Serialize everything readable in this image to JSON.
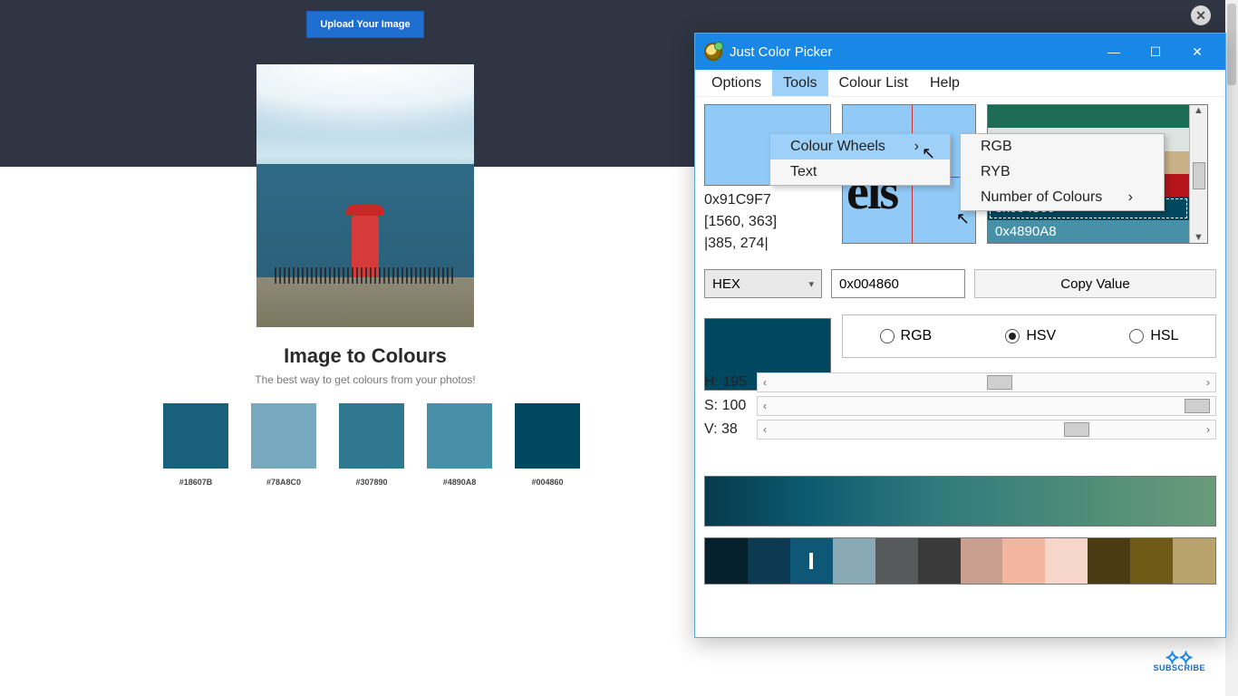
{
  "page": {
    "upload_label": "Upload Your Image",
    "title": "Image to Colours",
    "subtitle": "The best way to get colours from your photos!",
    "swatches": [
      {
        "hex": "#18607B",
        "label": "#18607B"
      },
      {
        "hex": "#78A8C0",
        "label": "#78A8C0"
      },
      {
        "hex": "#307890",
        "label": "#307890"
      },
      {
        "hex": "#4890A8",
        "label": "#4890A8"
      },
      {
        "hex": "#004860",
        "label": "#004860"
      }
    ]
  },
  "jcp": {
    "title": "Just Color Picker",
    "menus": {
      "options": "Options",
      "tools": "Tools",
      "colour_list": "Colour List",
      "help": "Help"
    },
    "tools_menu": {
      "colour_wheels": "Colour Wheels",
      "text": "Text"
    },
    "wheels_menu": {
      "rgb": "RGB",
      "ryb": "RYB",
      "num": "Number of Colours"
    },
    "sample": {
      "hex": "0x91C9F7",
      "coords1": "[1560, 363]",
      "coords2": "|385, 274|",
      "zoom_text": "els"
    },
    "history": [
      {
        "hex": "0x1E6B53",
        "bg": "#1E6B53",
        "text": ""
      },
      {
        "hex": "0xDDE3E0",
        "bg": "#DDE3E0",
        "text": ""
      },
      {
        "hex": "0xC9B087",
        "bg": "#C9B087",
        "text": ""
      },
      {
        "hex": "0xC0131A",
        "bg": "#B5141B",
        "text": ""
      },
      {
        "hex": "0x004860",
        "bg": "#004860",
        "text": "0x004860",
        "selected": true
      },
      {
        "hex": "0x4890A8",
        "bg": "#4890A8",
        "text": "0x4890A8"
      }
    ],
    "format_combo": "HEX",
    "hex_value": "0x004860",
    "copy_label": "Copy Value",
    "modes": {
      "rgb": "RGB",
      "hsv": "HSV",
      "hsl": "HSL",
      "selected": "hsv"
    },
    "hsv": {
      "h_label": "H:",
      "h": "195",
      "s_label": "S:",
      "s": "100",
      "v_label": "V:",
      "v": "38"
    },
    "shades": [
      "#06202e",
      "#0b3a52",
      "#0f5776",
      "#8aa9b6",
      "#565a5b",
      "#3a3a3a",
      "#c9a08f",
      "#f2b6a0",
      "#f6d6c8",
      "#4b3b12",
      "#6f5a16",
      "#b8a36c"
    ],
    "shade_marked_index": 2
  },
  "subscribe_label": "SUBSCRIBE"
}
